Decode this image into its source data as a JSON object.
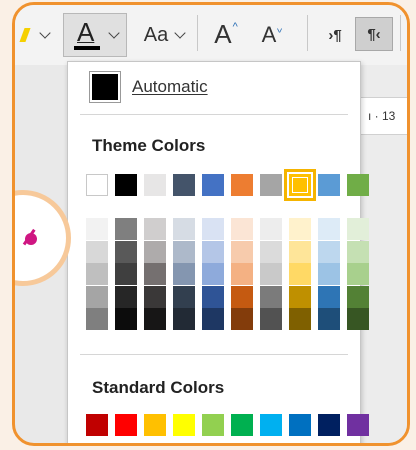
{
  "toolbar": {
    "font_size_label": "Aa",
    "grow_font": "A",
    "shrink_font": "A",
    "font_color_letter": "A",
    "font_color_underline": "#000000",
    "ltr_label": "›¶",
    "rtl_label": "¶‹"
  },
  "ruler": {
    "text": "ı · 13"
  },
  "font_color_menu": {
    "automatic": {
      "label": "Automatic",
      "color": "#000000"
    },
    "theme_title": "Theme Colors",
    "theme_base": [
      "#ffffff",
      "#000000",
      "#e7e6e6",
      "#44546a",
      "#4472c4",
      "#ed7d31",
      "#a5a5a5",
      "#ffc000",
      "#5b9bd5",
      "#70ad47"
    ],
    "theme_shades": [
      [
        "#f2f2f2",
        "#7f7f7f",
        "#d0cece",
        "#d6dce4",
        "#d9e2f3",
        "#fbe5d5",
        "#ededed",
        "#fff2cc",
        "#ddebf7",
        "#e2efd9"
      ],
      [
        "#d8d8d8",
        "#595959",
        "#aeabab",
        "#adb9ca",
        "#b4c6e7",
        "#f7cbac",
        "#dbdbdb",
        "#fee599",
        "#bdd7ee",
        "#c5e0b3"
      ],
      [
        "#bfbfbf",
        "#3f3f3f",
        "#757070",
        "#8496b0",
        "#8eaadb",
        "#f4b183",
        "#c9c9c9",
        "#ffd965",
        "#9cc3e5",
        "#a8d08d"
      ],
      [
        "#a5a5a5",
        "#262626",
        "#3a3838",
        "#323f4f",
        "#2f5496",
        "#c55a11",
        "#7b7b7b",
        "#bf9000",
        "#2e75b5",
        "#538135"
      ],
      [
        "#7f7f7f",
        "#0c0c0c",
        "#171616",
        "#222a35",
        "#1e3763",
        "#833c0b",
        "#525252",
        "#7f6000",
        "#1e4e79",
        "#375623"
      ]
    ],
    "selected_index": 7,
    "standard_title": "Standard Colors",
    "standard": [
      "#c00000",
      "#ff0000",
      "#ffc000",
      "#ffff00",
      "#92d050",
      "#00b050",
      "#00b0f0",
      "#0070c0",
      "#002060",
      "#7030a0"
    ]
  }
}
